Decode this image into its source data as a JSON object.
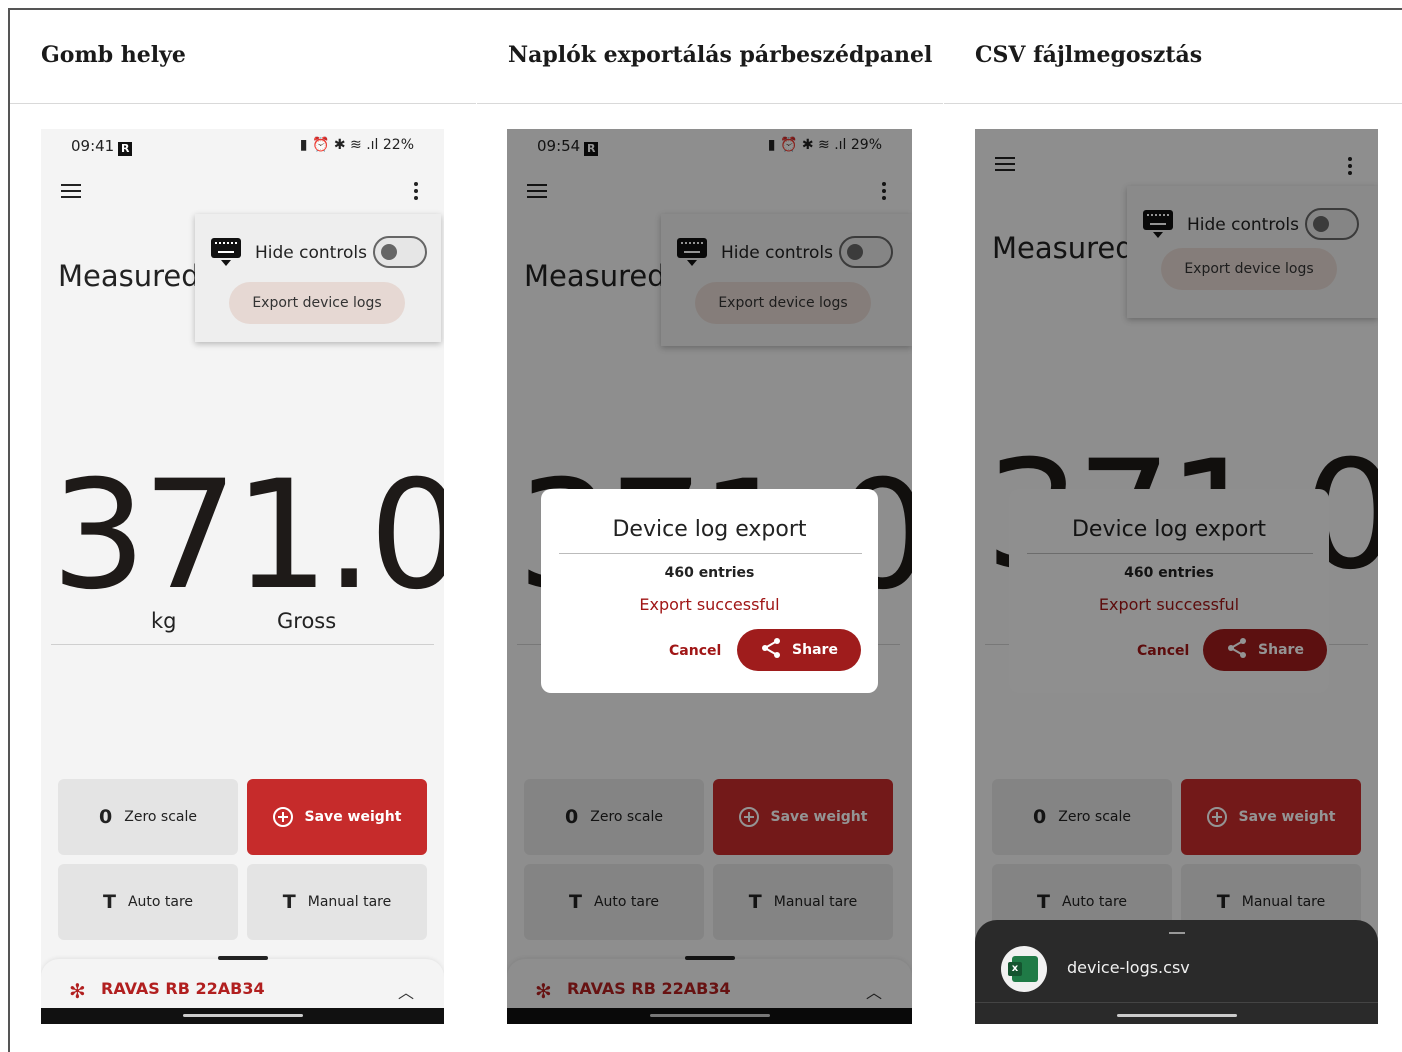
{
  "headers": [
    "Gomb helye",
    "Naplók exportálás párbeszédpanel",
    "CSV fájlmegosztás"
  ],
  "phones": [
    {
      "time": "09:41",
      "status_right": "22%",
      "measured_label": "Measured",
      "hide_controls": "Hide controls",
      "export_logs": "Export device logs",
      "weight": "371.0",
      "unit": "kg",
      "mode": "Gross",
      "zero_glyph": "0",
      "zero_label": "Zero scale",
      "save_label": "Save weight",
      "auto_tare_glyph": "T",
      "auto_tare_label": "Auto tare",
      "manual_tare_glyph": "T",
      "manual_tare_label": "Manual tare",
      "device_name": "RAVAS RB 22AB34"
    },
    {
      "time": "09:54",
      "status_right": "29%",
      "measured_label": "Measured",
      "hide_controls": "Hide controls",
      "export_logs": "Export device logs",
      "weight": "371.0",
      "zero_glyph": "0",
      "zero_label": "Zero scale",
      "save_label": "Save weight",
      "auto_tare_glyph": "T",
      "auto_tare_label": "Auto tare",
      "manual_tare_glyph": "T",
      "manual_tare_label": "Manual tare",
      "device_name": "RAVAS RB 22AB34",
      "dialog": {
        "title": "Device log export",
        "entries": "460 entries",
        "status": "Export successful",
        "cancel": "Cancel",
        "share": "Share"
      }
    },
    {
      "measured_label": "Measured",
      "hide_controls": "Hide controls",
      "export_logs": "Export device logs",
      "weight": "371.0",
      "zero_glyph": "0",
      "zero_label": "Zero scale",
      "save_label": "Save weight",
      "auto_tare_glyph": "T",
      "auto_tare_label": "Auto tare",
      "manual_tare_glyph": "T",
      "manual_tare_label": "Manual tare",
      "dialog": {
        "title": "Device log export",
        "entries": "460 entries",
        "status": "Export successful",
        "cancel": "Cancel",
        "share": "Share"
      },
      "file_name": "device-logs.csv",
      "file_icon": "excel-file-icon"
    }
  ],
  "colors": {
    "brand_red": "#c62b2b",
    "dialog_red": "#a01616",
    "share_button": "#9f1c1c"
  }
}
